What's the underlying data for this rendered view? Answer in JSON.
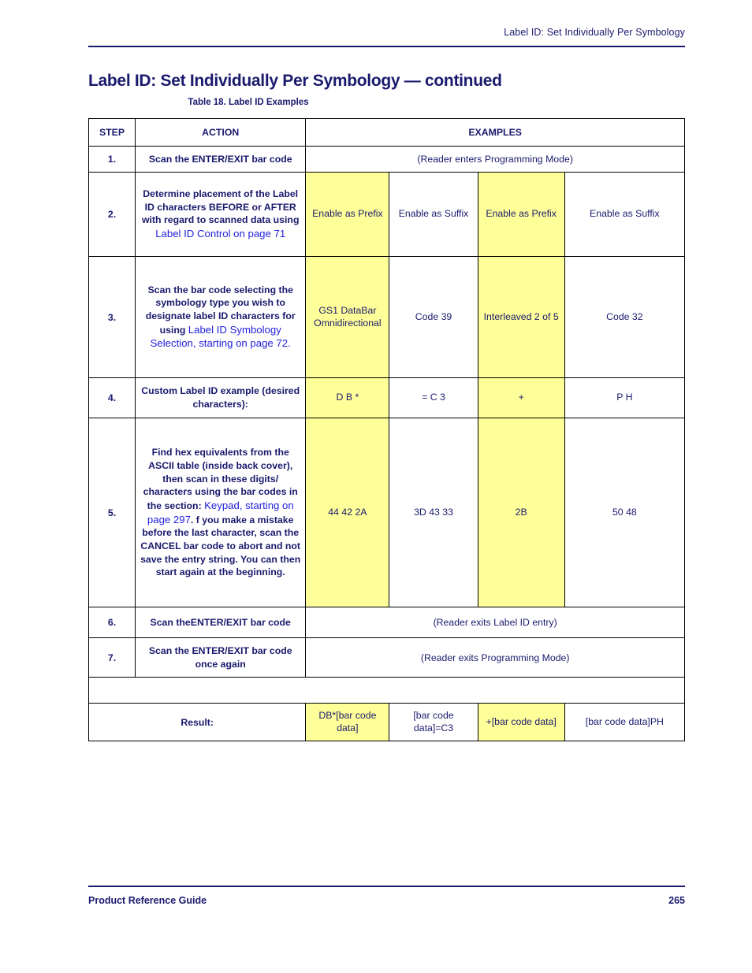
{
  "header": {
    "running_title": "Label ID: Set Individually Per Symbology"
  },
  "title": "Label ID: Set Individually Per Symbology — continued",
  "table": {
    "caption": "Table 18. Label ID Examples",
    "columns": [
      "STEP",
      "ACTION",
      "EXAMPLES"
    ],
    "rows": [
      {
        "step": "1.",
        "action": "Scan the ENTER/EXIT bar code",
        "span_example": "(Reader enters Programming Mode)"
      },
      {
        "step": "2.",
        "action_plain": "Determine placement of the Label ID characters  BEFORE or AFTER with regard to scanned data using ",
        "action_link": "Label ID Control on page 71",
        "examples": [
          "Enable as Prefix",
          "Enable as Suffix",
          "Enable as Prefix",
          "Enable as Suffix"
        ]
      },
      {
        "step": "3.",
        "action_plain": "Scan the bar code selecting the symbology type you wish to designate label ID characters for using ",
        "action_link": "Label ID Symbology Selection, starting on page 72.",
        "examples": [
          "GS1 DataBar Omnidirectional",
          "Code 39",
          "Interleaved 2 of 5",
          "Code 32"
        ]
      },
      {
        "step": "4.",
        "action": "Custom Label ID example (desired characters):",
        "examples": [
          "D  B   *",
          "=  C  3",
          "+",
          "P  H"
        ]
      },
      {
        "step": "5.",
        "action_plain": "Find hex equivalents from the ASCII table (inside back cover), then scan in these digits/ characters using the bar codes in the section:",
        "action_link": "Keypad, starting on page 297",
        "action_tail": ". f you make a mistake before the last character, scan the CANCEL bar code to abort and not save the entry string. You can then start again at the beginning.",
        "examples": [
          "44  42  2A",
          "3D  43  33",
          "2B",
          "50  48"
        ]
      },
      {
        "step": "6.",
        "action": "Scan theENTER/EXIT bar code",
        "span_example": "(Reader exits Label ID entry)"
      },
      {
        "step": "7.",
        "action": "Scan the ENTER/EXIT bar code once again",
        "span_example": "(Reader exits Programming Mode)"
      }
    ],
    "result": {
      "label": "Result:",
      "examples": [
        "DB*[bar code data]",
        "[bar code data]=C3",
        "+[bar code data]",
        "[bar code data]PH"
      ]
    }
  },
  "footer": {
    "left": "Product Reference Guide",
    "page_number": "265"
  },
  "colors": {
    "text_navy": "#1a1a6e",
    "link_blue": "#2222dd",
    "highlight_yellow": "#ffff99"
  }
}
